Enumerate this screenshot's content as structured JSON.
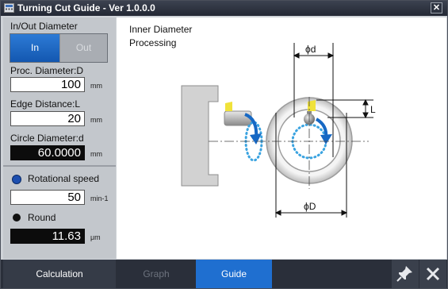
{
  "window": {
    "title": "Turning Cut Guide - Ver 1.0.0.0",
    "close_glyph": "✕",
    "app_icon": "calculator-icon"
  },
  "sidebar": {
    "inout_label": "In/Out Diameter",
    "toggle": {
      "in": "In",
      "out": "Out",
      "selected": "In"
    },
    "proc_label": "Proc. Diameter:D",
    "proc_value": "100",
    "proc_unit": "mm",
    "edge_label": "Edge Distance:L",
    "edge_value": "20",
    "edge_unit": "mm",
    "circle_label": "Circle Diameter:d",
    "circle_value": "60.0000",
    "circle_unit": "mm",
    "rot_label": "Rotational speed",
    "rot_value": "50",
    "rot_unit": "min-1",
    "round_label": "Round",
    "round_value": "11.63",
    "round_unit": "μm",
    "selected_mode": "Rotational speed"
  },
  "main": {
    "heading_line1": "Inner Diameter",
    "heading_line2": "Processing",
    "diagram": {
      "label_d": "ϕd",
      "label_D": "ϕD",
      "label_L": "L"
    }
  },
  "bottom": {
    "tab_calculation": "Calculation",
    "tab_graph": "Graph",
    "tab_guide": "Guide",
    "active_tab": "Guide",
    "pin_icon": "pin-icon",
    "close_icon": "close-icon"
  },
  "colors": {
    "accent": "#1f6fd0",
    "arrow": "#1668c4",
    "dotted": "#3aa3e0",
    "insert": "#f0e23a"
  }
}
